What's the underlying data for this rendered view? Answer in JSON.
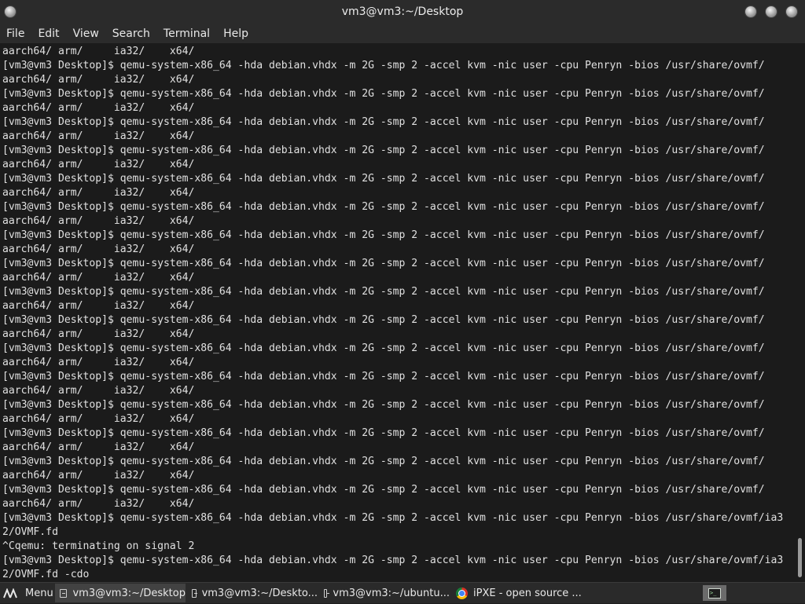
{
  "window": {
    "title": "vm3@vm3:~/Desktop"
  },
  "menu": {
    "items": [
      "File",
      "Edit",
      "View",
      "Search",
      "Terminal",
      "Help"
    ]
  },
  "terminal": {
    "lines": [
      "aarch64/ arm/     ia32/    x64/",
      "[vm3@vm3 Desktop]$ qemu-system-x86_64 -hda debian.vhdx -m 2G -smp 2 -accel kvm -nic user -cpu Penryn -bios /usr/share/ovmf/",
      "aarch64/ arm/     ia32/    x64/",
      "[vm3@vm3 Desktop]$ qemu-system-x86_64 -hda debian.vhdx -m 2G -smp 2 -accel kvm -nic user -cpu Penryn -bios /usr/share/ovmf/",
      "aarch64/ arm/     ia32/    x64/",
      "[vm3@vm3 Desktop]$ qemu-system-x86_64 -hda debian.vhdx -m 2G -smp 2 -accel kvm -nic user -cpu Penryn -bios /usr/share/ovmf/",
      "aarch64/ arm/     ia32/    x64/",
      "[vm3@vm3 Desktop]$ qemu-system-x86_64 -hda debian.vhdx -m 2G -smp 2 -accel kvm -nic user -cpu Penryn -bios /usr/share/ovmf/",
      "aarch64/ arm/     ia32/    x64/",
      "[vm3@vm3 Desktop]$ qemu-system-x86_64 -hda debian.vhdx -m 2G -smp 2 -accel kvm -nic user -cpu Penryn -bios /usr/share/ovmf/",
      "aarch64/ arm/     ia32/    x64/",
      "[vm3@vm3 Desktop]$ qemu-system-x86_64 -hda debian.vhdx -m 2G -smp 2 -accel kvm -nic user -cpu Penryn -bios /usr/share/ovmf/",
      "aarch64/ arm/     ia32/    x64/",
      "[vm3@vm3 Desktop]$ qemu-system-x86_64 -hda debian.vhdx -m 2G -smp 2 -accel kvm -nic user -cpu Penryn -bios /usr/share/ovmf/",
      "aarch64/ arm/     ia32/    x64/",
      "[vm3@vm3 Desktop]$ qemu-system-x86_64 -hda debian.vhdx -m 2G -smp 2 -accel kvm -nic user -cpu Penryn -bios /usr/share/ovmf/",
      "aarch64/ arm/     ia32/    x64/",
      "[vm3@vm3 Desktop]$ qemu-system-x86_64 -hda debian.vhdx -m 2G -smp 2 -accel kvm -nic user -cpu Penryn -bios /usr/share/ovmf/",
      "aarch64/ arm/     ia32/    x64/",
      "[vm3@vm3 Desktop]$ qemu-system-x86_64 -hda debian.vhdx -m 2G -smp 2 -accel kvm -nic user -cpu Penryn -bios /usr/share/ovmf/",
      "aarch64/ arm/     ia32/    x64/",
      "[vm3@vm3 Desktop]$ qemu-system-x86_64 -hda debian.vhdx -m 2G -smp 2 -accel kvm -nic user -cpu Penryn -bios /usr/share/ovmf/",
      "aarch64/ arm/     ia32/    x64/",
      "[vm3@vm3 Desktop]$ qemu-system-x86_64 -hda debian.vhdx -m 2G -smp 2 -accel kvm -nic user -cpu Penryn -bios /usr/share/ovmf/",
      "aarch64/ arm/     ia32/    x64/",
      "[vm3@vm3 Desktop]$ qemu-system-x86_64 -hda debian.vhdx -m 2G -smp 2 -accel kvm -nic user -cpu Penryn -bios /usr/share/ovmf/",
      "aarch64/ arm/     ia32/    x64/",
      "[vm3@vm3 Desktop]$ qemu-system-x86_64 -hda debian.vhdx -m 2G -smp 2 -accel kvm -nic user -cpu Penryn -bios /usr/share/ovmf/",
      "aarch64/ arm/     ia32/    x64/",
      "[vm3@vm3 Desktop]$ qemu-system-x86_64 -hda debian.vhdx -m 2G -smp 2 -accel kvm -nic user -cpu Penryn -bios /usr/share/ovmf/",
      "aarch64/ arm/     ia32/    x64/",
      "[vm3@vm3 Desktop]$ qemu-system-x86_64 -hda debian.vhdx -m 2G -smp 2 -accel kvm -nic user -cpu Penryn -bios /usr/share/ovmf/",
      "aarch64/ arm/     ia32/    x64/",
      "[vm3@vm3 Desktop]$ qemu-system-x86_64 -hda debian.vhdx -m 2G -smp 2 -accel kvm -nic user -cpu Penryn -bios /usr/share/ovmf/ia3",
      "2/OVMF.fd",
      "^Cqemu: terminating on signal 2",
      "[vm3@vm3 Desktop]$ qemu-system-x86_64 -hda debian.vhdx -m 2G -smp 2 -accel kvm -nic user -cpu Penryn -bios /usr/share/ovmf/ia3",
      "2/OVMF.fd -cdo"
    ]
  },
  "taskbar": {
    "menu_label": "Menu",
    "tasks": [
      {
        "label": "vm3@vm3:~/Desktop",
        "icon": "terminal-icon",
        "active": true
      },
      {
        "label": "vm3@vm3:~/Deskto...",
        "icon": "terminal-icon",
        "active": false
      },
      {
        "label": "vm3@vm3:~/ubuntu...",
        "icon": "terminal-icon",
        "active": false
      },
      {
        "label": "iPXE - open source ...",
        "icon": "chrome-icon",
        "active": false
      }
    ],
    "tray": {
      "icon": "terminal-tray-icon",
      "glyph": ">_"
    }
  },
  "colors": {
    "window_bg": "#1b1b1b",
    "chrome_bg": "#2b2b2b",
    "text": "#e0e0e0",
    "active_task": "#424242"
  }
}
